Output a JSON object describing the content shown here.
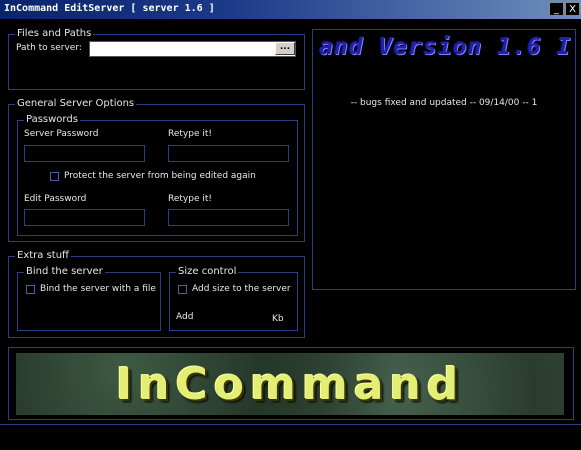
{
  "window": {
    "title": "InCommand EditServer [ server 1.6 ]",
    "minimize": "_",
    "close": "X"
  },
  "files": {
    "legend": "Files and Paths",
    "path_label": "Path to server:",
    "path_value": "",
    "browse_label": "..."
  },
  "general": {
    "legend": "General Server Options",
    "passwords_legend": "Passwords",
    "server_password_label": "Server Password",
    "retype1_label": "Retype it!",
    "protect_label": "Protect the server from being edited again",
    "edit_password_label": "Edit Password",
    "retype2_label": "Retype it!"
  },
  "extra": {
    "legend": "Extra stuff",
    "bind_legend": "Bind the server",
    "bind_label": "Bind the server with a file",
    "size_legend": "Size control",
    "size_label": "Add size to the server",
    "add_label": "Add",
    "kb_label": "Kb"
  },
  "news": {
    "version_text": "and Version 1.6    I",
    "bugs_text": "-- bugs fixed and updated -- 09/14/00 -- 1"
  },
  "logo": {
    "text": "InCommand"
  },
  "colors": {
    "accent_border": "#2b3f87",
    "logo_text": "#e2ef74",
    "title_bar": "#0a246a"
  }
}
